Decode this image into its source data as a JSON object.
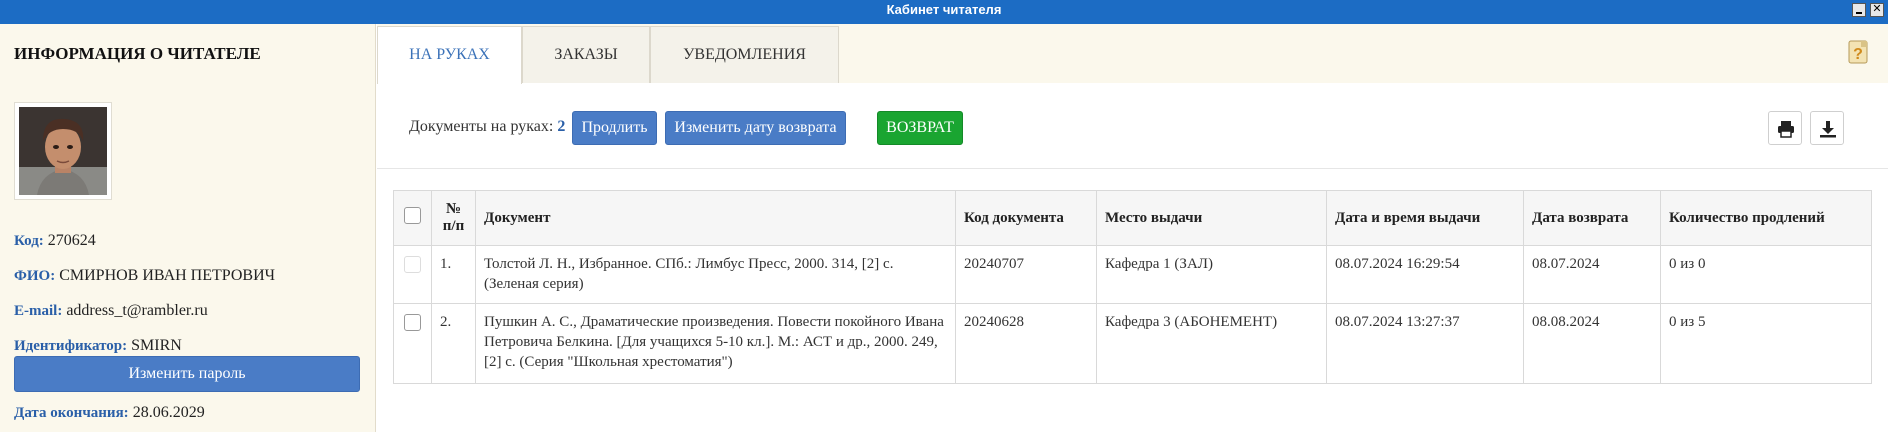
{
  "window": {
    "title": "Кабинет читателя"
  },
  "sidebar": {
    "title": "ИНФОРМАЦИЯ О ЧИТАТЕЛЕ",
    "fields": [
      {
        "label": "Код:",
        "value": "270624"
      },
      {
        "label": "ФИО:",
        "value": "СМИРНОВ ИВАН ПЕТРОВИЧ"
      },
      {
        "label": "E-mail:",
        "value": "address_t@rambler.ru"
      },
      {
        "label": "Идентификатор:",
        "value": "SMIRN"
      }
    ],
    "change_password_label": "Изменить пароль",
    "expiry": {
      "label": "Дата окончания:",
      "value": "28.06.2029"
    }
  },
  "tabs": [
    {
      "label": "НА РУКАХ",
      "active": true
    },
    {
      "label": "ЗАКАЗЫ",
      "active": false
    },
    {
      "label": "УВЕДОМЛЕНИЯ",
      "active": false
    }
  ],
  "toolbar": {
    "docs_label": "Документы на руках:",
    "docs_count": "2",
    "extend_label": "Продлить",
    "change_date_label": "Изменить дату возврата",
    "return_label": "ВОЗВРАТ"
  },
  "icons": {
    "help": "help-icon",
    "print": "print-icon",
    "download": "download-icon"
  },
  "colors": {
    "titlebar": "#1c6cc4",
    "primary_button": "#4a7cc6",
    "return_button": "#1aa531",
    "label": "#2a5fa8"
  },
  "table": {
    "headers": [
      "№ п/п",
      "Документ",
      "Код документа",
      "Место выдачи",
      "Дата и время выдачи",
      "Дата возврата",
      "Количество продлений"
    ],
    "rows": [
      [
        "1.",
        "Толстой Л. Н., Избранное. СПб.: Лимбус Пресс, 2000. 314, [2] с. (Зеленая серия)",
        "20240707",
        "Кафедра 1 (ЗАЛ)",
        "08.07.2024 16:29:54",
        "08.07.2024",
        "0 из 0"
      ],
      [
        "2.",
        "Пушкин А. С., Драматические произведения. Повести покойного Ивана Петровича Белкина. [Для учащихся 5-10 кл.]. М.: АСТ и др., 2000. 249, [2] с. (Серия \"Школьная хрестоматия\")",
        "20240628",
        "Кафедра 3 (АБОНЕМЕНТ)",
        "08.07.2024 13:27:37",
        "08.08.2024",
        "0 из 5"
      ]
    ]
  }
}
